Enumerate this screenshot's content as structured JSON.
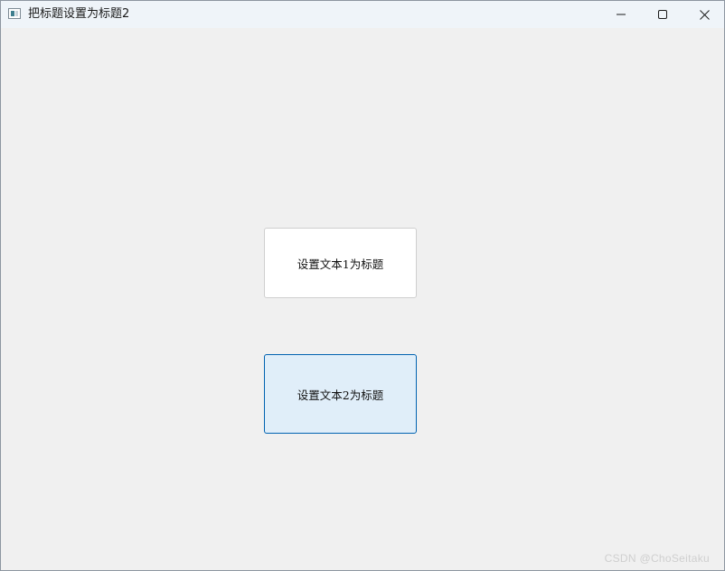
{
  "window": {
    "title": "把标题设置为标题2",
    "controls": {
      "minimize_icon": "minimize-icon",
      "maximize_icon": "maximize-icon",
      "close_icon": "close-icon"
    }
  },
  "buttons": {
    "set_title_1": "设置文本1为标题",
    "set_title_2": "设置文本2为标题"
  },
  "watermark": "CSDN @ChoSeitaku",
  "colors": {
    "window_bg": "#f0f0f0",
    "titlebar_bg": "#eff4f9",
    "focus_border": "#0063b1",
    "focus_fill": "#e0eef9"
  }
}
